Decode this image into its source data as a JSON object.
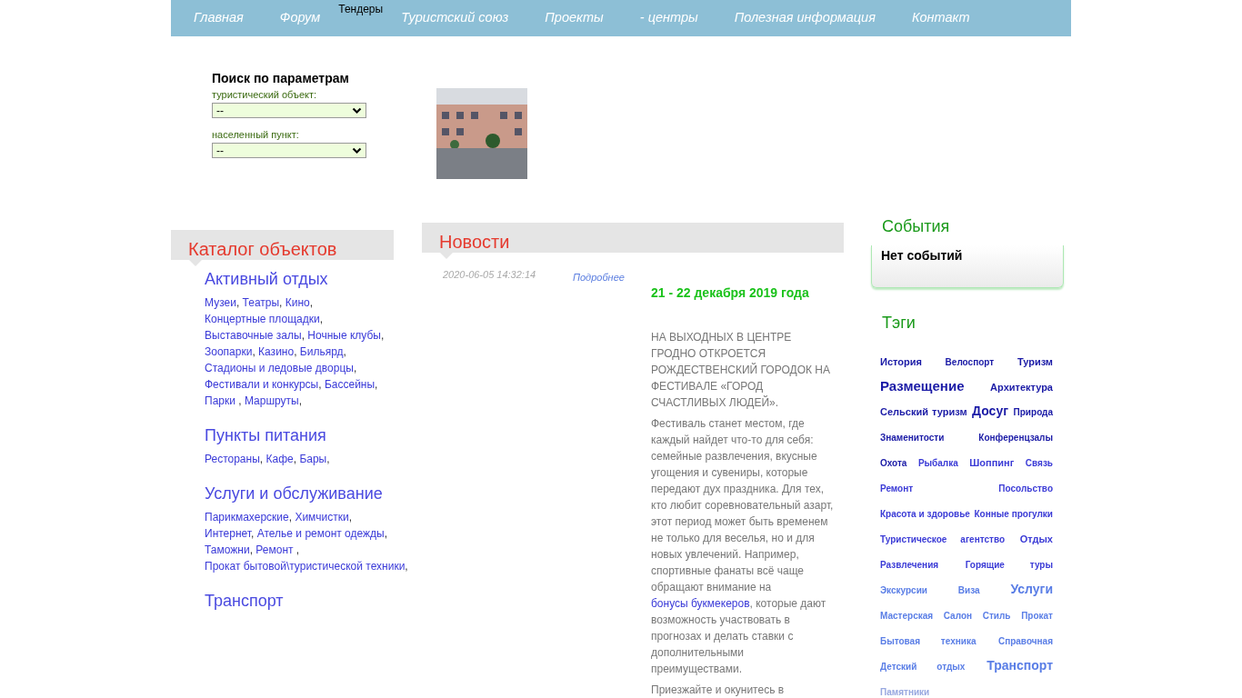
{
  "nav": [
    {
      "label": "Главная",
      "kind": "main"
    },
    {
      "label": "Форум",
      "kind": "main"
    },
    {
      "label": "Тендеры",
      "kind": "raised"
    },
    {
      "label": "Туристский союз",
      "kind": "main"
    },
    {
      "label": "Проекты",
      "kind": "main"
    },
    {
      "label": "- центры",
      "kind": "main"
    },
    {
      "label": "Полезная информация",
      "kind": "main"
    },
    {
      "label": "Контакт",
      "kind": "main"
    }
  ],
  "search": {
    "title": "Поиск по параметрам",
    "fields": [
      {
        "label": "туристический объект:",
        "value": "--"
      },
      {
        "label": "населенный пункт:",
        "value": "--"
      }
    ]
  },
  "catalog": {
    "title": "Каталог объектов",
    "sections": [
      {
        "title": "Активный отдых",
        "links": [
          {
            "label": "Музеи",
            "sep": ","
          },
          {
            "label": "Театры",
            "sep": ","
          },
          {
            "label": "Кино",
            "sep": ","
          },
          {
            "label": "Концертные площадки",
            "sep": ","
          },
          {
            "label": "Выставочные залы",
            "sep": ","
          },
          {
            "label": "Ночные клубы",
            "sep": ","
          },
          {
            "label": "Зоопарки",
            "sep": ","
          },
          {
            "label": "Казино",
            "sep": ","
          },
          {
            "label": "Бильярд",
            "sep": ","
          },
          {
            "label": "Стадионы и ледовые дворцы",
            "sep": ","
          },
          {
            "label": "Фестивали и конкурсы",
            "sep": ","
          },
          {
            "label": "Бассейны",
            "sep": ","
          },
          {
            "label": "Парки",
            "sep": " ,"
          },
          {
            "label": "Маршруты",
            "sep": ","
          }
        ]
      },
      {
        "title": "Пункты питания",
        "links": [
          {
            "label": "Рестораны",
            "sep": ","
          },
          {
            "label": "Кафе",
            "sep": ","
          },
          {
            "label": "Бары",
            "sep": ","
          }
        ]
      },
      {
        "title": "Услуги и обслуживание",
        "links": [
          {
            "label": "Парикмахерские",
            "sep": ","
          },
          {
            "label": "Химчистки",
            "sep": ","
          },
          {
            "label": "Интернет",
            "sep": ","
          },
          {
            "label": "Ателье и ремонт одежды",
            "sep": ","
          },
          {
            "label": "Таможни",
            "sep": ","
          },
          {
            "label": "Ремонт",
            "sep": " ,"
          },
          {
            "label": "Прокат бытовой\\туристической техники",
            "sep": ","
          }
        ]
      },
      {
        "title": "Транспорт"
      }
    ]
  },
  "news": {
    "title": "Новости",
    "items": [
      {
        "date": "2020-06-05 14:32:14",
        "more": "Подробнее",
        "headline": "21 - 22 декабря 2019 года",
        "paragraphs": [
          {
            "segments": [
              {
                "text": "НА ВЫХОДНЫХ В ЦЕНТРЕ ГРОДНО ОТКРОЕТСЯ РОЖДЕСТВЕНСКИЙ ГОРОДОК НА ФЕСТИВАЛЕ «ГОРОД СЧАСТЛИВЫХ ЛЮДЕЙ».",
                "kind": "plain"
              }
            ]
          },
          {
            "segments": [
              {
                "text": "Фестиваль станет местом, где каждый найдет что-то для себя: семейные развлечения, вкусные угощения и сувениры, которые передают дух праздника. Для тех, кто любит соревновательный азарт, этот период может быть временем не только для веселья, но и для новых увлечений. Например, спортивные фанаты всё чаще обращают внимание на",
                "kind": "plain"
              },
              {
                "text": "бонусы букмекеров",
                "kind": "link"
              },
              {
                "text": ", которые дают возможность участвовать в прогнозах и делать ставки с дополнительными преимуществами.",
                "kind": "plain"
              }
            ]
          },
          {
            "segments": [
              {
                "text": "Приезжайте и окунитесь в",
                "kind": "plain"
              }
            ]
          }
        ]
      }
    ]
  },
  "events": {
    "title": "События",
    "empty": "Нет событий"
  },
  "tags": {
    "title": "Тэги",
    "items": [
      {
        "label": "История",
        "kind": "m",
        "color": "#1a1aa6"
      },
      {
        "label": "Велоспорт",
        "kind": "s",
        "color": "#1a1aa6"
      },
      {
        "label": "Туризм",
        "kind": "m",
        "color": "#1a1aa6"
      },
      {
        "label": "Размещение",
        "kind": "xl",
        "color": "#1a1aa6"
      },
      {
        "label": "Архитектура",
        "kind": "m",
        "color": "#1a1aa6"
      },
      {
        "label": "Сельский туризм",
        "kind": "m",
        "color": "#1a1aa6"
      },
      {
        "label": "Досуг",
        "kind": "l",
        "color": "#1a1aa6"
      },
      {
        "label": "Природа",
        "kind": "s",
        "color": "#1a1aa6"
      },
      {
        "label": "Знаменитости",
        "kind": "s",
        "color": "#1a1aa6"
      },
      {
        "label": "Конференцзалы",
        "kind": "s",
        "color": "#1a1aa6"
      },
      {
        "label": "Охота",
        "kind": "s",
        "color": "#1a1aa6"
      },
      {
        "label": "Рыбалка",
        "kind": "s",
        "color": "#3b3bd6"
      },
      {
        "label": "Шоппинг",
        "kind": "m",
        "color": "#3b3bd6"
      },
      {
        "label": "Связь",
        "kind": "s",
        "color": "#3b3bd6"
      },
      {
        "label": "Ремонт",
        "kind": "s",
        "color": "#3b3bd6"
      },
      {
        "label": "Посольство",
        "kind": "s",
        "color": "#3b3bd6"
      },
      {
        "label": "Красота и здоровье",
        "kind": "s",
        "color": "#3b3bd6"
      },
      {
        "label": "Конные прогулки",
        "kind": "s",
        "color": "#3b3bd6"
      },
      {
        "label": "Туристическое агентство",
        "kind": "s",
        "color": "#3b3bd6"
      },
      {
        "label": "Отдых",
        "kind": "m",
        "color": "#3b3bd6"
      },
      {
        "label": "Развлечения",
        "kind": "s",
        "color": "#3b3bd6"
      },
      {
        "label": "Горящие туры",
        "kind": "s",
        "color": "#3b3bd6"
      },
      {
        "label": "Экскурсии",
        "kind": "s",
        "color": "#5a7ee6"
      },
      {
        "label": "Виза",
        "kind": "s",
        "color": "#5a7ee6"
      },
      {
        "label": "Услуги",
        "kind": "l",
        "color": "#5a7ee6"
      },
      {
        "label": "Мастерская",
        "kind": "s",
        "color": "#5a7ee6"
      },
      {
        "label": "Салон",
        "kind": "s",
        "color": "#5a7ee6"
      },
      {
        "label": "Стиль",
        "kind": "s",
        "color": "#5a7ee6"
      },
      {
        "label": "Прокат",
        "kind": "s",
        "color": "#5a7ee6"
      },
      {
        "label": "Бытовая техника",
        "kind": "s",
        "color": "#5a7ee6"
      },
      {
        "label": "Справочная",
        "kind": "s",
        "color": "#5a7ee6"
      },
      {
        "label": "Детский отдых",
        "kind": "s",
        "color": "#5a7ee6"
      },
      {
        "label": "Транспорт",
        "kind": "l",
        "color": "#5a7ee6"
      },
      {
        "label": "Памятники",
        "kind": "s",
        "color": "#98a8e0"
      }
    ]
  }
}
